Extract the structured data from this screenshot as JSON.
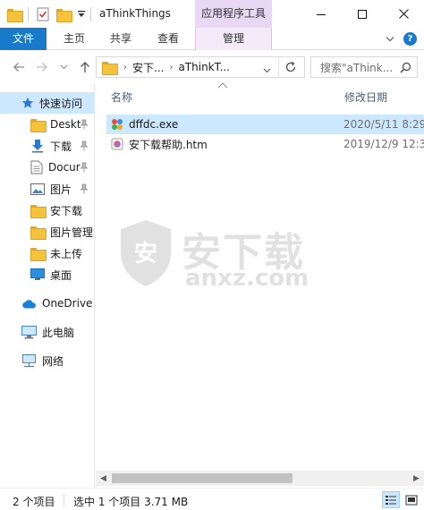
{
  "window": {
    "title": "aThinkThings",
    "context_tab": "应用程序工具"
  },
  "ribbon": {
    "tabs": [
      {
        "label": "文件"
      },
      {
        "label": "主页"
      },
      {
        "label": "共享"
      },
      {
        "label": "查看"
      },
      {
        "label": "管理"
      }
    ]
  },
  "address": {
    "crumbs": [
      "安下...",
      "aThinkT..."
    ],
    "search_placeholder": "搜索\"aThink..."
  },
  "sidebar": {
    "items": [
      {
        "label": "快速访问",
        "icon": "star-icon",
        "pinned": false,
        "selected": true
      },
      {
        "label": "Deskt",
        "icon": "folder-icon",
        "pinned": true
      },
      {
        "label": "下载",
        "icon": "download-icon",
        "pinned": true
      },
      {
        "label": "Docur",
        "icon": "document-icon",
        "pinned": true
      },
      {
        "label": "图片",
        "icon": "pictures-icon",
        "pinned": true
      },
      {
        "label": "安下载",
        "icon": "folder-icon",
        "pinned": false
      },
      {
        "label": "图片管理",
        "icon": "folder-icon",
        "pinned": false
      },
      {
        "label": "未上传",
        "icon": "folder-icon",
        "pinned": false
      },
      {
        "label": "桌面",
        "icon": "desktop-icon",
        "pinned": false
      },
      {
        "label": "OneDrive",
        "icon": "cloud-icon",
        "pinned": false
      },
      {
        "label": "此电脑",
        "icon": "computer-icon",
        "pinned": false
      },
      {
        "label": "网络",
        "icon": "network-icon",
        "pinned": false
      }
    ]
  },
  "columns": {
    "name": "名称",
    "date": "修改日期"
  },
  "files": [
    {
      "name": "dffdc.exe",
      "date": "2020/5/11 8:29",
      "icon": "app-exe-icon",
      "selected": true
    },
    {
      "name": "安下载帮助.htm",
      "date": "2019/12/9 12:3",
      "icon": "htm-file-icon",
      "selected": false
    }
  ],
  "watermark": {
    "text": "安下载",
    "sub": "anxz.com",
    "badge": "安"
  },
  "status": {
    "count": "2 个项目",
    "selection": "选中 1 个项目  3.71 MB"
  },
  "colors": {
    "accent": "#1979ca",
    "selection": "#cce8ff",
    "context_tab": "#e9d8f4",
    "folder": "#f5c33b"
  }
}
